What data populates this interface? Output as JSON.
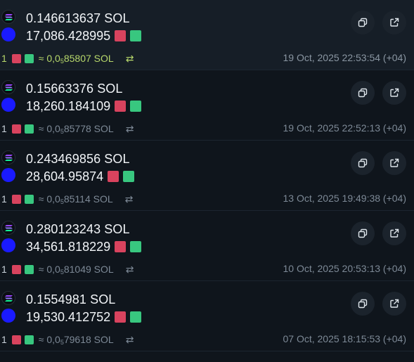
{
  "rows": [
    {
      "sol_amount": "0.146613637 SOL",
      "token_amount": "17,086.428995",
      "count": "1",
      "price_prefix": "≈ 0,0",
      "price_sub": "5",
      "price_suffix": "85807 SOL",
      "swap_icon": "⇄",
      "timestamp": "19 Oct, 2025 22:53:54 (+04)",
      "highlighted": true
    },
    {
      "sol_amount": "0.15663376 SOL",
      "token_amount": "18,260.184109",
      "count": "1",
      "price_prefix": "≈ 0,0",
      "price_sub": "5",
      "price_suffix": "85778 SOL",
      "swap_icon": "⇄",
      "timestamp": "19 Oct, 2025 22:52:13 (+04)",
      "highlighted": false
    },
    {
      "sol_amount": "0.243469856 SOL",
      "token_amount": "28,604.95874",
      "count": "1",
      "price_prefix": "≈ 0,0",
      "price_sub": "5",
      "price_suffix": "85114 SOL",
      "swap_icon": "⇄",
      "timestamp": "13 Oct, 2025 19:49:38 (+04)",
      "highlighted": false
    },
    {
      "sol_amount": "0.280123243 SOL",
      "token_amount": "34,561.818229",
      "count": "1",
      "price_prefix": "≈ 0,0",
      "price_sub": "5",
      "price_suffix": "81049 SOL",
      "swap_icon": "⇄",
      "timestamp": "10 Oct, 2025 20:53:13 (+04)",
      "highlighted": false
    },
    {
      "sol_amount": "0.1554981 SOL",
      "token_amount": "19,530.412752",
      "count": "1",
      "price_prefix": "≈ 0,0",
      "price_sub": "5",
      "price_suffix": "79618 SOL",
      "swap_icon": "⇄",
      "timestamp": "07 Oct, 2025 18:15:53 (+04)",
      "highlighted": false
    }
  ],
  "icons": {
    "token": "solana-logo-icon",
    "wallet": "wallet-avatar-icon",
    "copy": "copy-icon",
    "open": "external-link-icon",
    "swap": "swap-arrows-icon",
    "tag_red": "red-tag-icon",
    "tag_green": "green-tag-icon"
  },
  "colors": {
    "background": "#0f151c",
    "highlight_row": "#161e27",
    "highlight_text": "#b7d86b",
    "wallet_dot": "#1a1aff",
    "tag_red": "#d8435e",
    "tag_green": "#38c77f",
    "muted_text": "#7d8996"
  }
}
